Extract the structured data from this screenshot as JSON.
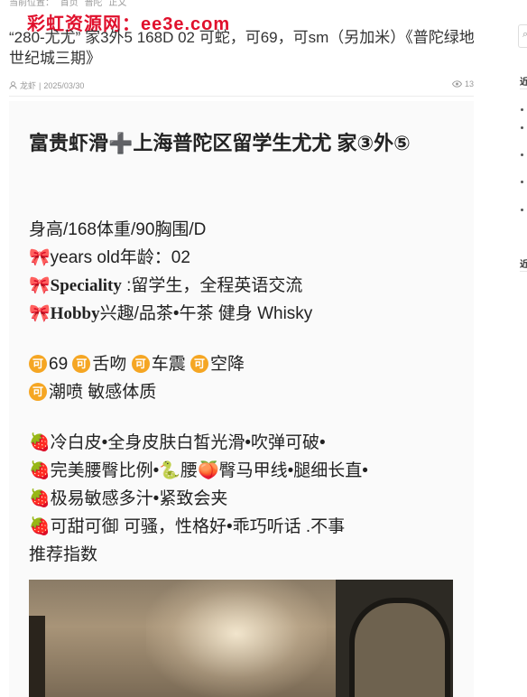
{
  "breadcrumb": [
    "当前位置：",
    "首页",
    "普陀",
    "正文"
  ],
  "watermark": "彩虹资源网：ee3e.com",
  "post": {
    "title": "“280-尤尤” 家3外5 168D 02 可蛇，可69，可sm（另加米）《普陀绿地世纪城三期》",
    "author": "龙虾",
    "date": "2025/03/30",
    "views": "13"
  },
  "article": {
    "heading": "富贵虾滑➕上海普陀区留学生尤尤 家③外⑤",
    "stats": "身高/168体重/90胸围/D",
    "age": {
      "emoji": "🎀",
      "label": "years old年龄：02"
    },
    "speciality": {
      "emoji": "🎀",
      "label": "Speciality",
      "value": " :留学生，全程英语交流"
    },
    "hobby": {
      "emoji": "🎀",
      "label": "Hobby",
      "value": "兴趣/品茶•午茶   健身  Whisky"
    },
    "badge_char": "可",
    "services_line1": [
      {
        "text": "69"
      },
      {
        "text": "舌吻"
      },
      {
        "text": "车震"
      },
      {
        "text": "空降"
      }
    ],
    "services_line2": [
      {
        "text": "潮喷  敏感体质"
      }
    ],
    "features": [
      {
        "emoji": "🍓",
        "text": "冷白皮•全身皮肤白皙光滑•吹弹可破•"
      },
      {
        "emoji": "🍓",
        "text": "完美腰臀比例•🐍腰🍑臀马甲线•腿细长直•"
      },
      {
        "emoji": "🍓",
        "text": "极易敏感多汁•紧致会夹"
      },
      {
        "emoji": "🍓",
        "text": "可甜可御 可骚，性格好•乖巧听话 .不事"
      }
    ],
    "recommend": "推荐指数"
  },
  "sidebar": {
    "search_icon": "search-icon",
    "recent_head": "近",
    "recent_head2": "近"
  }
}
